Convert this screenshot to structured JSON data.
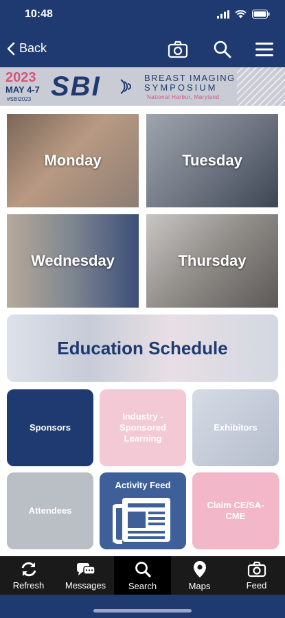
{
  "status": {
    "time": "10:48"
  },
  "nav": {
    "back_label": "Back"
  },
  "banner": {
    "year": "2023",
    "dates": "MAY 4-7",
    "hashtag": "#SBI2023",
    "logo": "SBI",
    "title_line1": "BREAST IMAGING",
    "title_line2": "SYMPOSIUM",
    "location": "National Harbor, Maryland"
  },
  "days": [
    {
      "label": "Monday"
    },
    {
      "label": "Tuesday"
    },
    {
      "label": "Wednesday"
    },
    {
      "label": "Thursday"
    }
  ],
  "education": {
    "label": "Education Schedule"
  },
  "tiles": [
    {
      "label": "Sponsors",
      "color": "#1f3a70"
    },
    {
      "label": "Industry - Sponsored Learning",
      "color": "#f3c9d6"
    },
    {
      "label": "Exhibitors",
      "color": "#c5ccda"
    },
    {
      "label": "Attendees",
      "color": "#b9bfc5"
    },
    {
      "label": "Activity Feed",
      "color": "#3f5f98"
    },
    {
      "label": "Claim CE/SA-CME",
      "color": "#f2b7c8"
    }
  ],
  "tabbar": {
    "items": [
      {
        "label": "Refresh",
        "icon": "refresh-icon"
      },
      {
        "label": "Messages",
        "icon": "messages-icon"
      },
      {
        "label": "Search",
        "icon": "search-icon"
      },
      {
        "label": "Maps",
        "icon": "map-pin-icon"
      },
      {
        "label": "Feed",
        "icon": "camera-icon"
      }
    ]
  }
}
